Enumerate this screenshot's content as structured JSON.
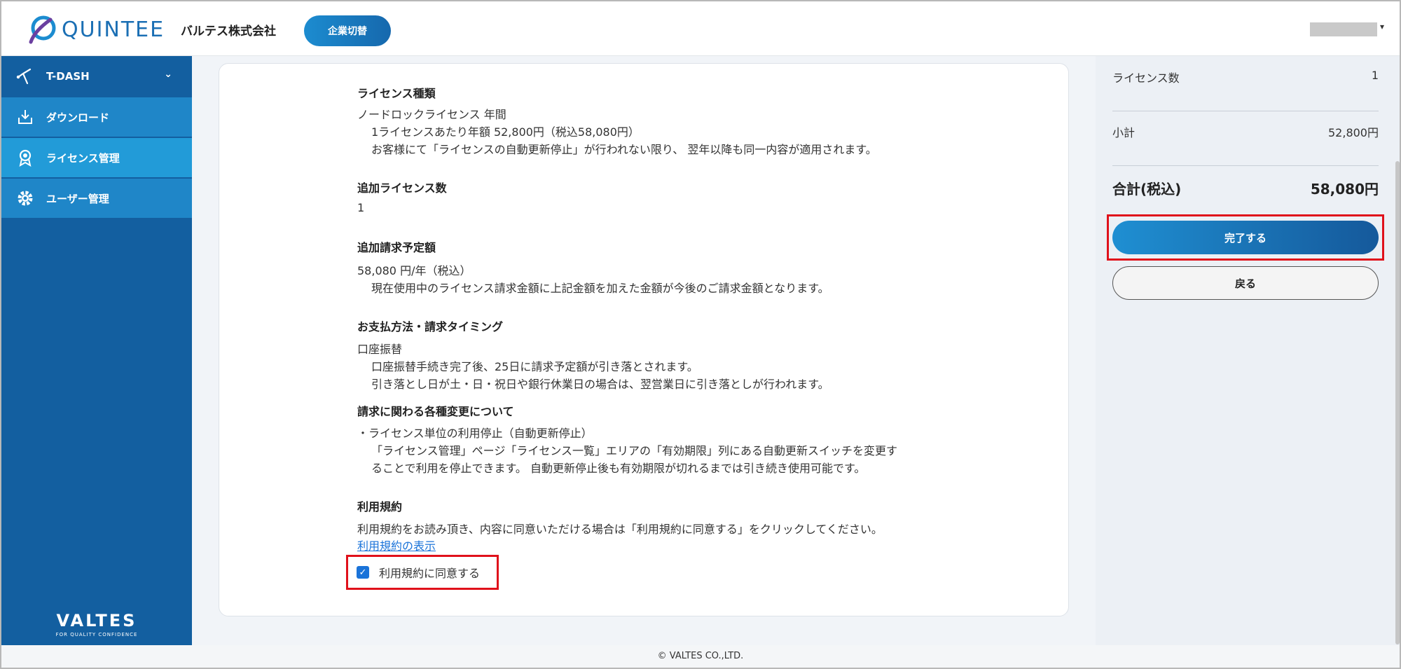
{
  "header": {
    "logo_text": "QUINTEE",
    "company": "バルテス株式会社",
    "switch_label": "企業切替",
    "user_caret": "▾"
  },
  "sidebar": {
    "items": [
      {
        "label": "T-DASH",
        "icon": "tdash-icon"
      },
      {
        "label": "ダウンロード",
        "icon": "download-icon"
      },
      {
        "label": "ライセンス管理",
        "icon": "award-icon"
      },
      {
        "label": "ユーザー管理",
        "icon": "gear-icon"
      }
    ],
    "brand": "VALTES",
    "brand_tagline": "FOR QUALITY CONFIDENCE"
  },
  "main": {
    "license_type": {
      "heading": "ライセンス種類",
      "line1": "ノードロックライセンス 年間",
      "line2": "1ライセンスあたり年額 52,800円（税込58,080円）",
      "line3": "お客様にて「ライセンスの自動更新停止」が行われない限り、 翌年以降も同一内容が適用されます。"
    },
    "additional_count": {
      "heading": "追加ライセンス数",
      "value": "1"
    },
    "additional_billing": {
      "heading": "追加請求予定額",
      "line1": "58,080 円/年（税込）",
      "line2": "現在使用中のライセンス請求金額に上記金額を加えた金額が今後のご請求金額となります。"
    },
    "payment": {
      "heading": "お支払方法・請求タイミング",
      "line1": "口座振替",
      "line2": "口座振替手続き完了後、25日に請求予定額が引き落とされます。",
      "line3": "引き落とし日が土・日・祝日や銀行休業日の場合は、翌営業日に引き落としが行われます。"
    },
    "changes": {
      "heading": "請求に関わる各種変更について",
      "line1": "・ライセンス単位の利用停止（自動更新停止）",
      "line2": "「ライセンス管理」ページ「ライセンス一覧」エリアの「有効期限」列にある自動更新スイッチを変更す",
      "line3": "ることで利用を停止できます。 自動更新停止後も有効期限が切れるまでは引き続き使用可能です。"
    },
    "terms": {
      "heading": "利用規約",
      "line1": "利用規約をお読み頂き、内容に同意いただける場合は「利用規約に同意する」をクリックしてください。",
      "link": "利用規約の表示",
      "agree_label": "利用規約に同意する",
      "agree_checked": true
    }
  },
  "summary": {
    "license_count_label": "ライセンス数",
    "license_count_value": "1",
    "subtotal_label": "小計",
    "subtotal_value": "52,800円",
    "total_label": "合計(税込)",
    "total_value": "58,080円",
    "complete_label": "完了する",
    "back_label": "戻る"
  },
  "footer": {
    "copyright": "© VALTES CO.,LTD."
  },
  "colors": {
    "sidebar": "#135fa0",
    "sidebar_active": "#229bd8",
    "accent": "#1a73d9",
    "highlight": "#e0111b"
  }
}
